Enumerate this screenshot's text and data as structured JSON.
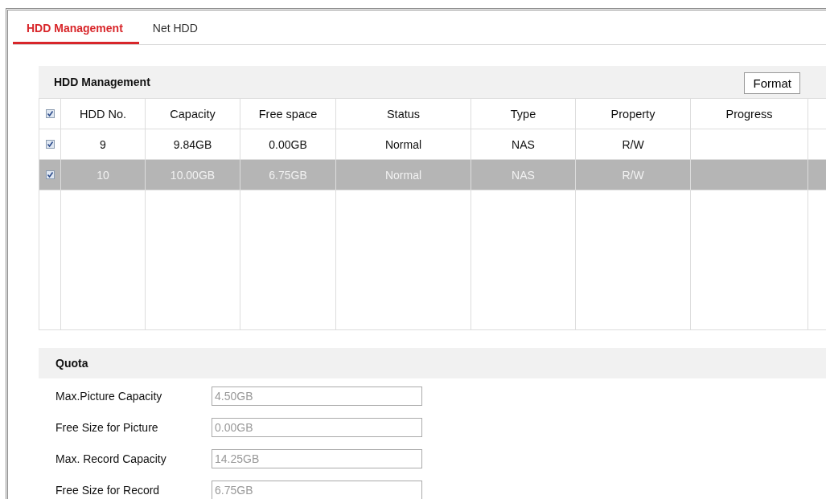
{
  "tabs": [
    {
      "label": "HDD Management",
      "selected": true
    },
    {
      "label": "Net HDD",
      "selected": false
    }
  ],
  "hdd_panel": {
    "title": "HDD Management",
    "format_button": "Format",
    "table": {
      "select_all_checked": true,
      "columns": [
        "HDD No.",
        "Capacity",
        "Free space",
        "Status",
        "Type",
        "Property",
        "Progress"
      ],
      "rows": [
        {
          "checked": true,
          "selected": false,
          "cells": [
            "9",
            "9.84GB",
            "0.00GB",
            "Normal",
            "NAS",
            "R/W",
            ""
          ]
        },
        {
          "checked": true,
          "selected": true,
          "cells": [
            "10",
            "10.00GB",
            "6.75GB",
            "Normal",
            "NAS",
            "R/W",
            ""
          ]
        }
      ]
    }
  },
  "quota": {
    "title": "Quota",
    "fields": [
      {
        "label": "Max.Picture Capacity",
        "value": "4.50GB",
        "disabled": true
      },
      {
        "label": "Free Size for Picture",
        "value": "0.00GB",
        "disabled": true
      },
      {
        "label": "Max. Record Capacity",
        "value": "14.25GB",
        "disabled": true
      },
      {
        "label": "Free Size for Record",
        "value": "6.75GB",
        "disabled": true
      }
    ]
  }
}
